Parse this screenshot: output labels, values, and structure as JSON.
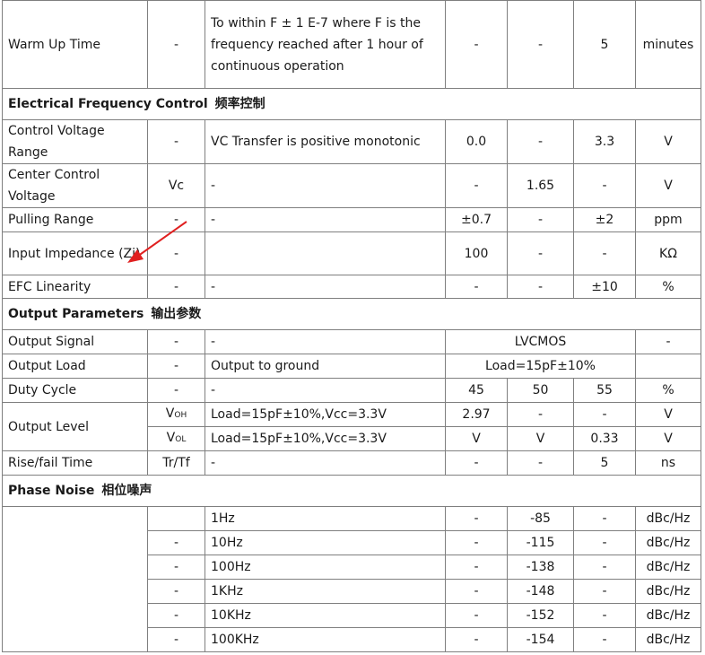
{
  "warmup": {
    "param": "Warm Up Time",
    "sym": "-",
    "cond": "To within F ± 1 E-7 where F is the frequency reached after 1 hour of continuous operation",
    "min": "-",
    "typ": "-",
    "max": "5",
    "unit": "minutes"
  },
  "efc_section": {
    "en": "Electrical Frequency Control",
    "cn": "频率控制"
  },
  "efc_rows": [
    {
      "param": "Control Voltage Range",
      "sym": "-",
      "cond": "VC Transfer is positive monotonic",
      "min": "0.0",
      "typ": "-",
      "max": "3.3",
      "unit": "V"
    },
    {
      "param": "Center Control Voltage",
      "sym": "Vc",
      "cond": "-",
      "min": "-",
      "typ": "1.65",
      "max": "-",
      "unit": "V"
    },
    {
      "param": "Pulling Range",
      "sym": "-",
      "cond": "-",
      "min": "±0.7",
      "typ": "-",
      "max": "±2",
      "unit": "ppm"
    },
    {
      "param": "Input Impedance (Zi)",
      "sym": "-",
      "cond": "",
      "min": "100",
      "typ": "-",
      "max": "-",
      "unit": "KΩ"
    },
    {
      "param": "EFC Linearity",
      "sym": "-",
      "cond": "-",
      "min": "-",
      "typ": "-",
      "max": "±10",
      "unit": "%"
    }
  ],
  "output_section": {
    "en": "Output Parameters",
    "cn": "输出参数"
  },
  "output_signal": {
    "param": "Output Signal",
    "sym": "-",
    "cond": "-",
    "value": "LVCMOS",
    "unit": "-"
  },
  "output_load": {
    "param": "Output Load",
    "sym": "-",
    "cond": "Output to ground",
    "value": "Load=15pF±10%",
    "unit": ""
  },
  "duty_cycle": {
    "param": "Duty Cycle",
    "sym": "-",
    "cond": "-",
    "min": "45",
    "typ": "50",
    "max": "55",
    "unit": "%"
  },
  "output_level": {
    "param": "Output Level",
    "voh": {
      "sym": "V",
      "sub": "OH",
      "cond": "Load=15pF±10%,Vcc=3.3V",
      "min": "2.97",
      "typ": "-",
      "max": "-",
      "unit": "V"
    },
    "vol": {
      "sym": "V",
      "sub": "OL",
      "cond": "Load=15pF±10%,Vcc=3.3V",
      "min": "V",
      "typ": "V",
      "max": "0.33",
      "unit": "V"
    }
  },
  "rise_fall": {
    "param": "Rise/fail Time",
    "sym": "Tr/Tf",
    "cond": "-",
    "min": "-",
    "typ": "-",
    "max": "5",
    "unit": "ns"
  },
  "phase_section": {
    "en": "Phase Noise",
    "cn": "相位噪声"
  },
  "phase_rows": [
    {
      "sym": "",
      "cond": "1Hz",
      "min": "-",
      "typ": "-85",
      "max": "-",
      "unit": "dBc/Hz"
    },
    {
      "sym": "-",
      "cond": "10Hz",
      "min": "-",
      "typ": "-115",
      "max": "-",
      "unit": "dBc/Hz"
    },
    {
      "sym": "-",
      "cond": "100Hz",
      "min": "-",
      "typ": "-138",
      "max": "-",
      "unit": "dBc/Hz"
    },
    {
      "sym": "-",
      "cond": "1KHz",
      "min": "-",
      "typ": "-148",
      "max": "-",
      "unit": "dBc/Hz"
    },
    {
      "sym": "-",
      "cond": "10KHz",
      "min": "-",
      "typ": "-152",
      "max": "-",
      "unit": "dBc/Hz"
    },
    {
      "sym": "-",
      "cond": "100KHz",
      "min": "-",
      "typ": "-154",
      "max": "-",
      "unit": "dBc/Hz"
    }
  ],
  "colors": {
    "highlight": "#3b8fd6",
    "arrow": "#e02020",
    "border": "#7f7f7f"
  }
}
